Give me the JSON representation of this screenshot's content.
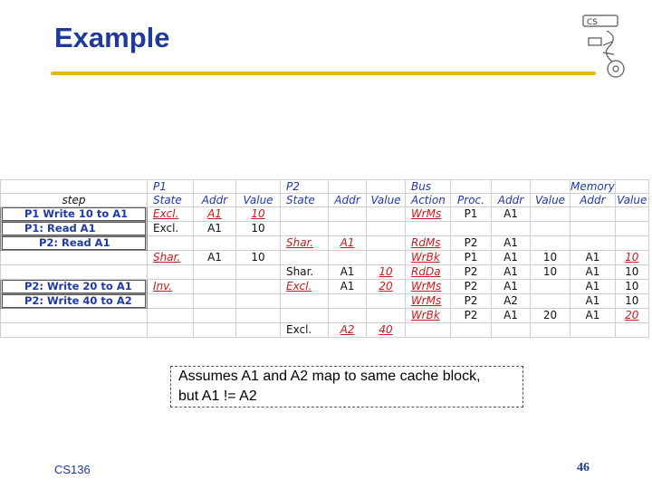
{
  "title": "Example",
  "logo": {
    "text": "CS"
  },
  "header1": [
    "",
    "P1",
    "",
    "",
    "P2",
    "",
    "",
    "Bus",
    "",
    "",
    "",
    "Memory",
    ""
  ],
  "header2": [
    "step",
    "State",
    "Addr",
    "Value",
    "State",
    "Addr",
    "Value",
    "Action",
    "Proc.",
    "Addr",
    "Value",
    "Addr",
    "Value"
  ],
  "steps": [
    "P1 Write 10 to A1",
    "P1: Read A1",
    "P2: Read A1",
    "",
    "",
    "",
    "P2: Write 20 to A1",
    "P2: Write 40 to A2",
    "",
    ""
  ],
  "rows": [
    [
      "",
      "Excl.",
      "A1",
      "10",
      "",
      "",
      "",
      "WrMs",
      "P1",
      "A1",
      "",
      "",
      ""
    ],
    [
      "",
      "Excl.",
      "A1",
      "10",
      "",
      "",
      "",
      "",
      "",
      "",
      "",
      "",
      ""
    ],
    [
      "",
      "",
      "",
      "",
      "Shar.",
      "A1",
      "",
      "RdMs",
      "P2",
      "A1",
      "",
      "",
      ""
    ],
    [
      "",
      "Shar.",
      "A1",
      "10",
      "",
      "",
      "",
      "WrBk",
      "P1",
      "A1",
      "10",
      "A1",
      "10"
    ],
    [
      "",
      "",
      "",
      "",
      "Shar.",
      "A1",
      "10",
      "RdDa",
      "P2",
      "A1",
      "10",
      "A1",
      "10"
    ],
    [
      "",
      "Inv.",
      "",
      "",
      "Excl.",
      "A1",
      "20",
      "WrMs",
      "P2",
      "A1",
      "",
      "A1",
      "10"
    ],
    [
      "",
      "",
      "",
      "",
      "",
      "",
      "",
      "WrMs",
      "P2",
      "A2",
      "",
      "A1",
      "10"
    ],
    [
      "",
      "",
      "",
      "",
      "",
      "",
      "",
      "WrBk",
      "P2",
      "A1",
      "20",
      "A1",
      "20"
    ],
    [
      "",
      "",
      "",
      "",
      "Excl.",
      "A2",
      "40",
      "",
      "",
      "",
      "",
      "",
      ""
    ]
  ],
  "note": {
    "line1": "Assumes A1 and A2 map to same cache block,",
    "line2": "but A1 != A2"
  },
  "footer": "CS136",
  "page_number": "46"
}
